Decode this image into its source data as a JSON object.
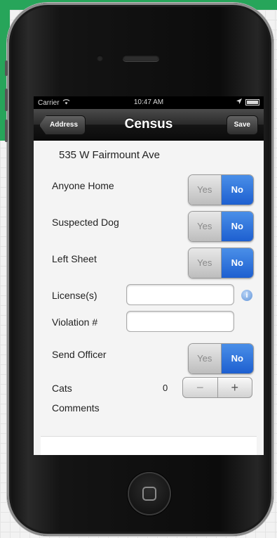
{
  "statusbar": {
    "carrier": "Carrier",
    "time": "10:47 AM"
  },
  "navbar": {
    "back_label": "Address",
    "title": "Census",
    "save_label": "Save"
  },
  "form": {
    "address": "535 W Fairmount Ave",
    "anyone_home": {
      "label": "Anyone Home",
      "yes": "Yes",
      "no": "No",
      "selected": "No"
    },
    "suspected_dog": {
      "label": "Suspected Dog",
      "yes": "Yes",
      "no": "No",
      "selected": "No"
    },
    "left_sheet": {
      "label": "Left Sheet",
      "yes": "Yes",
      "no": "No",
      "selected": "No"
    },
    "license": {
      "label": "License(s)",
      "value": ""
    },
    "violation": {
      "label": "Violation #",
      "value": ""
    },
    "send_officer": {
      "label": "Send Officer",
      "yes": "Yes",
      "no": "No",
      "selected": "No"
    },
    "cats": {
      "label": "Cats",
      "value": "0",
      "minus": "−",
      "plus": "+"
    },
    "comments": {
      "label": "Comments",
      "value": ""
    }
  },
  "colors": {
    "accent_green": "#27a55a",
    "toggle_selected_blue": "#1d5fd0"
  },
  "icons": {
    "wifi": "wifi-icon",
    "location": "location-arrow-icon",
    "battery": "battery-icon",
    "info": "info-icon"
  }
}
